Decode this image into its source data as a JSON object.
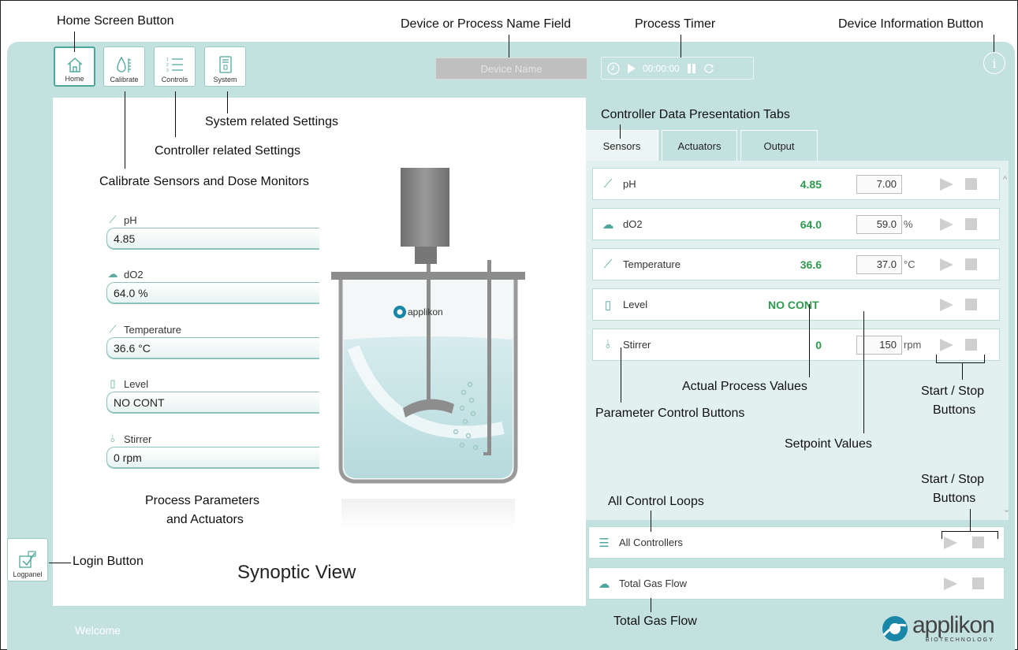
{
  "toolbar": {
    "buttons": [
      {
        "label": "Home",
        "icon": "home-icon"
      },
      {
        "label": "Calibrate",
        "icon": "calibrate-icon"
      },
      {
        "label": "Controls",
        "icon": "controls-list-icon"
      },
      {
        "label": "System",
        "icon": "system-icon"
      }
    ],
    "device_name_placeholder": "Device Name",
    "timer_value": "00:00:00"
  },
  "synoptic": {
    "title": "Synoptic View",
    "parameters": [
      {
        "label": "pH",
        "value": "4.85",
        "icon": "ph-probe-icon"
      },
      {
        "label": "dO2",
        "value": "64.0 %",
        "icon": "cloud-icon"
      },
      {
        "label": "Temperature",
        "value": "36.6 °C",
        "icon": "thermometer-icon"
      },
      {
        "label": "Level",
        "value": "NO CONT",
        "icon": "level-beaker-icon"
      },
      {
        "label": "Stirrer",
        "value": "0 rpm",
        "icon": "stirrer-icon"
      }
    ],
    "welcome": "Welcome",
    "logpanel_label": "Logpanel",
    "brand_in_vessel": "applikon"
  },
  "tabs": [
    "Sensors",
    "Actuators",
    "Output"
  ],
  "controllers": [
    {
      "name": "pH",
      "actual": "4.85",
      "setpoint": "7.00",
      "unit": "",
      "icon": "ph-probe-icon"
    },
    {
      "name": "dO2",
      "actual": "64.0",
      "setpoint": "59.0",
      "unit": "%",
      "icon": "cloud-icon"
    },
    {
      "name": "Temperature",
      "actual": "36.6",
      "setpoint": "37.0",
      "unit": "°C",
      "icon": "thermometer-icon"
    },
    {
      "name": "Level",
      "status": "NO CONT",
      "icon": "level-beaker-icon"
    },
    {
      "name": "Stirrer",
      "actual": "0",
      "setpoint": "150",
      "unit": "rpm",
      "icon": "stirrer-icon"
    }
  ],
  "bottom_rows": [
    {
      "name": "All Controllers",
      "icon": "all-controllers-icon"
    },
    {
      "name": "Total Gas Flow",
      "icon": "cloud-icon"
    }
  ],
  "brand": {
    "name": "applikon",
    "tagline": "BIOTECHNOLOGY",
    "accent": "#1a86a8"
  },
  "colors": {
    "app_bg": "#c3e2df",
    "accent": "#4ea79c",
    "actual_value": "#2d9a4c"
  },
  "annotations": {
    "home_screen_button": "Home Screen Button",
    "device_name_field": "Device or Process Name Field",
    "process_timer": "Process Timer",
    "device_info_button": "Device Information Button",
    "system_settings": "System related Settings",
    "controller_settings": "Controller related Settings",
    "calibrate": "Calibrate Sensors and Dose Monitors",
    "data_tabs": "Controller Data Presentation Tabs",
    "process_params_1": "Process Parameters",
    "process_params_2": "and Actuators",
    "login_button": "Login Button",
    "actual_values": "Actual Process Values",
    "param_control_buttons": "Parameter Control Buttons",
    "setpoint_values": "Setpoint Values",
    "start_stop_1": "Start / Stop",
    "start_stop_2": "Buttons",
    "all_control_loops": "All Control Loops",
    "total_gas_flow": "Total Gas Flow"
  }
}
